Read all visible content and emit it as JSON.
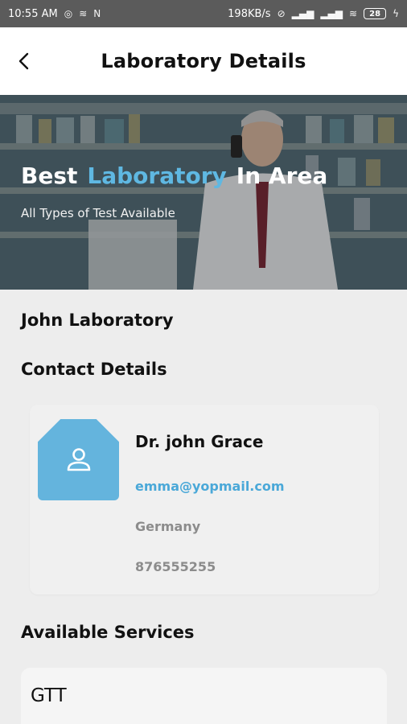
{
  "status_bar": {
    "time": "10:55 AM",
    "network_speed": "198KB/s",
    "battery": "28",
    "icons": [
      "whatsapp-icon",
      "wifi-icon",
      "n-icon",
      "alarm-icon",
      "signal-icon",
      "signal-icon",
      "wifi-icon",
      "charging-icon"
    ]
  },
  "header": {
    "title": "Laboratory Details",
    "back_icon": "chevron-left-icon"
  },
  "hero": {
    "headline_part1": "Best",
    "headline_accent": "Laboratory",
    "headline_part2": "In Area",
    "subtitle": "All Types of Test Available",
    "accent_color": "#5fb8e2"
  },
  "lab": {
    "name": "John Laboratory"
  },
  "contact": {
    "section_title": "Contact Details",
    "doctor_name": "Dr. john Grace",
    "email": "emma@yopmail.com",
    "country": "Germany",
    "phone": "876555255",
    "avatar_icon": "user-icon",
    "avatar_color": "#64b4dd"
  },
  "services": {
    "section_title": "Available Services",
    "items": [
      "GTT"
    ]
  }
}
